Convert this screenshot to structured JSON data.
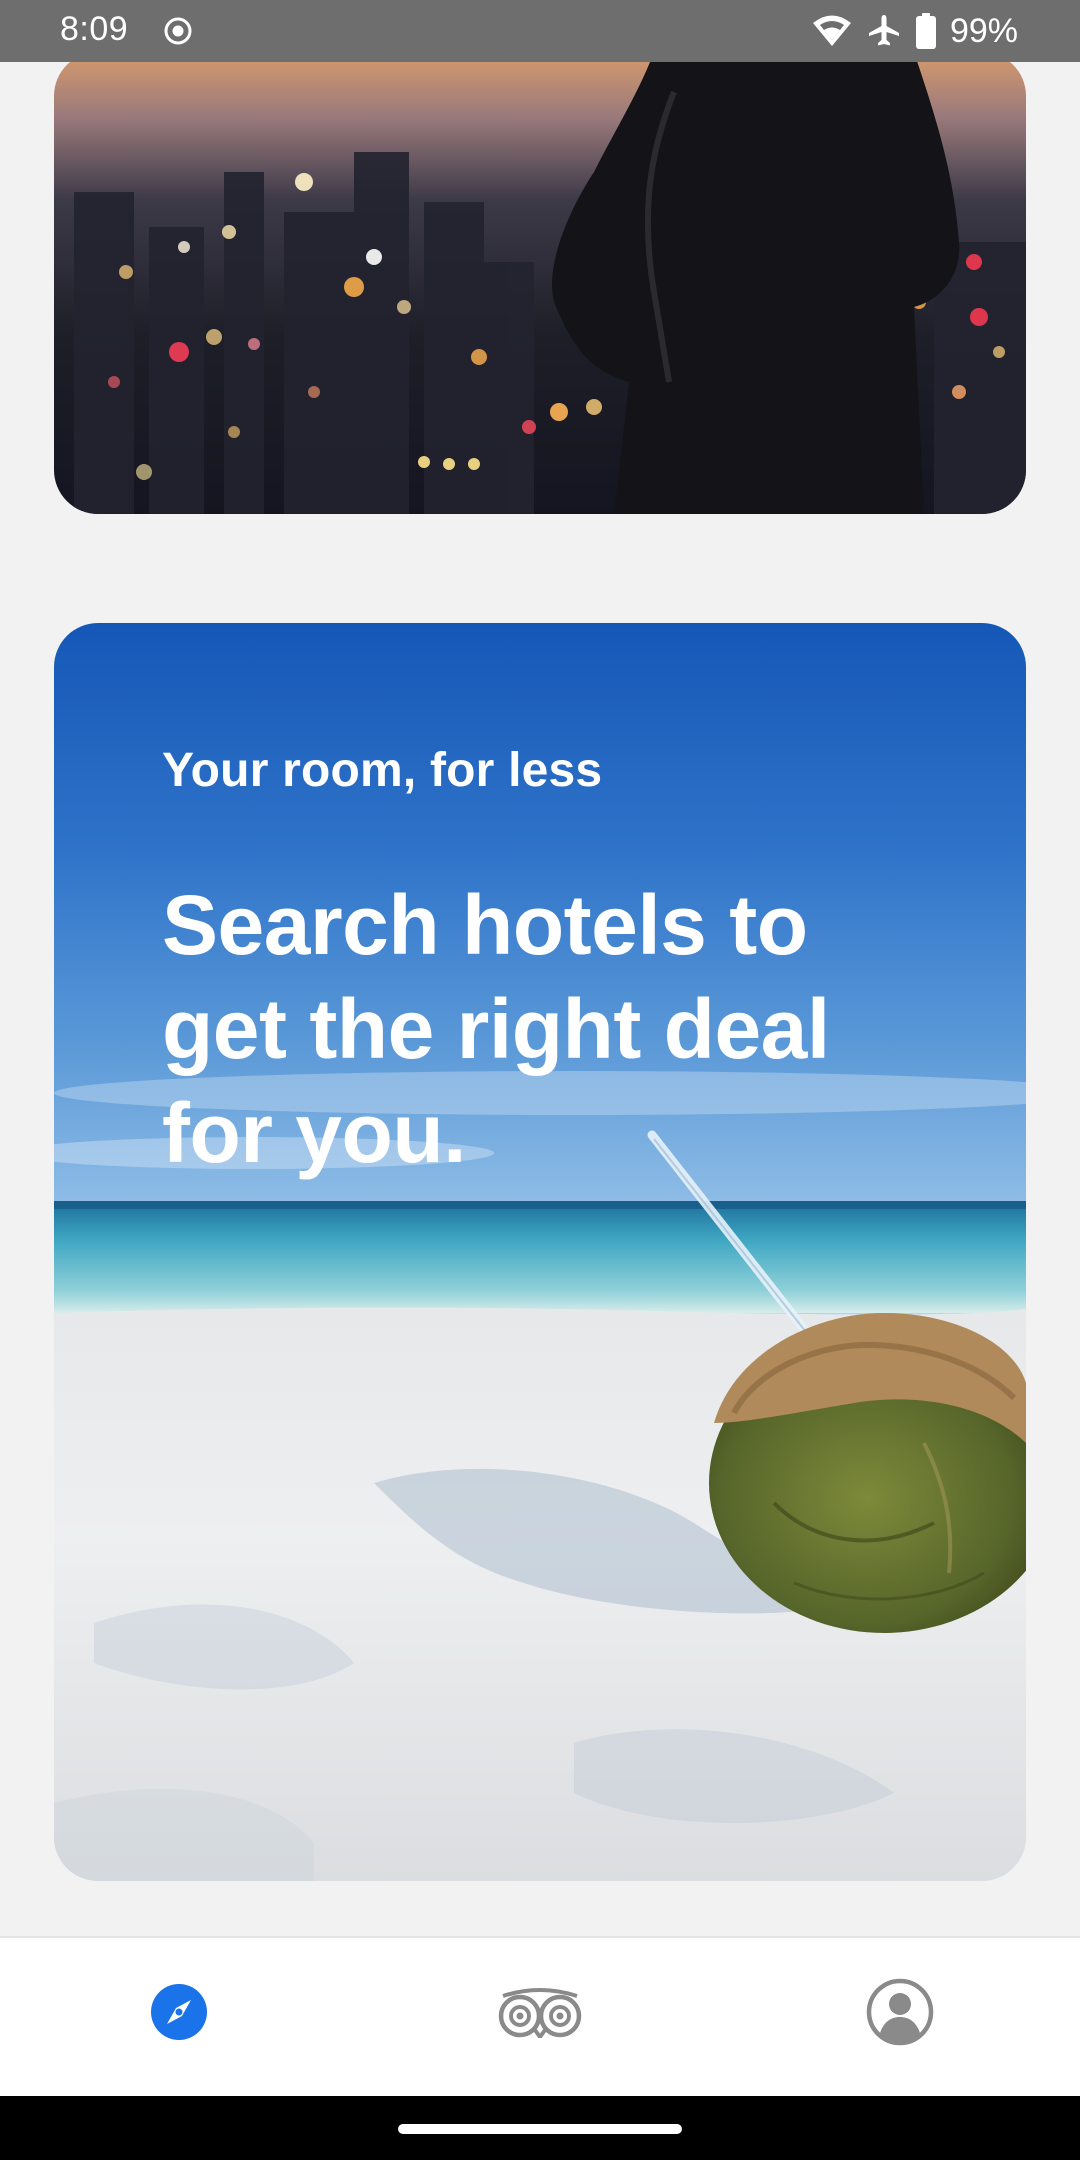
{
  "status_bar": {
    "time": "8:09",
    "battery": "99%",
    "icons": [
      "screen-record-icon",
      "wifi-icon",
      "airplane-mode-icon",
      "battery-icon"
    ]
  },
  "cards": {
    "city": {
      "image": "city-skyline-at-dusk"
    },
    "beach": {
      "image": "coconut-on-beach",
      "eyebrow": "Your room, for less",
      "headline": "Search hotels to get the right deal for you."
    }
  },
  "bottom_nav": {
    "items": [
      {
        "icon": "compass-icon",
        "selected": true
      },
      {
        "icon": "owl-logo-icon",
        "selected": false
      },
      {
        "icon": "profile-icon",
        "selected": false
      }
    ]
  },
  "colors": {
    "accent": "#1a73e8",
    "nav_inactive": "#8a8a8a",
    "status_bar": "#6e6e6e",
    "page_background": "#f2f2f2"
  }
}
